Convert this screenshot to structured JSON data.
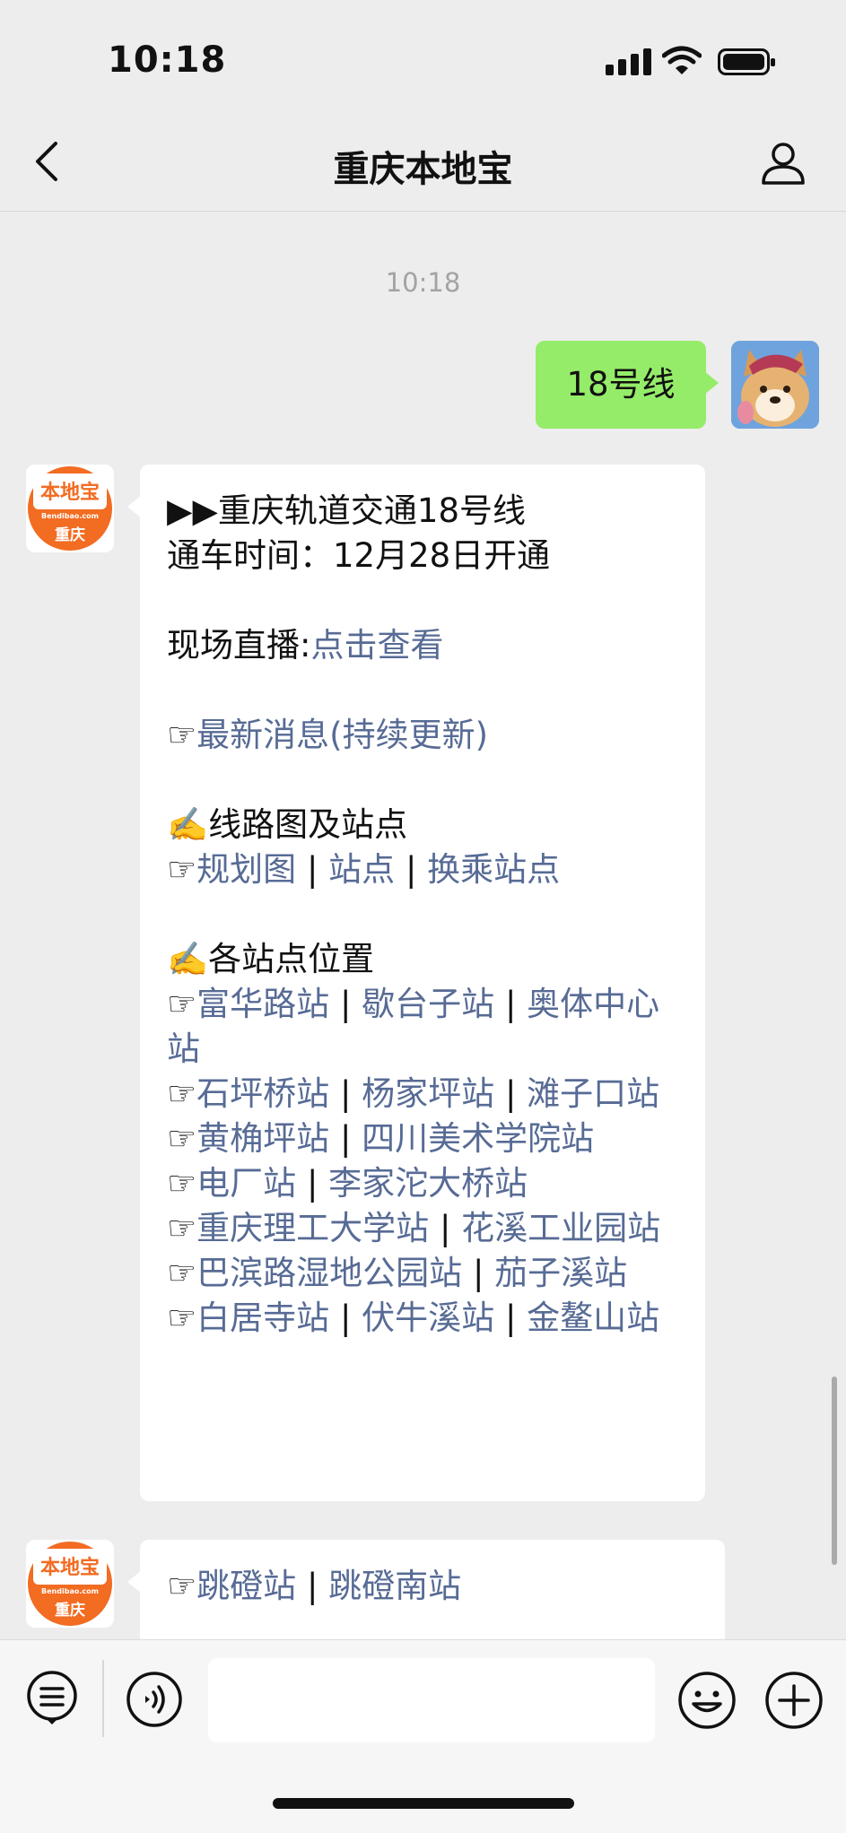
{
  "status_bar": {
    "time": "10:18"
  },
  "nav": {
    "title": "重庆本地宝"
  },
  "chat": {
    "timestamp": "10:18",
    "outgoing": {
      "text": "18号线"
    },
    "bot_avatar": {
      "logo_text": "本地宝",
      "site": "Bendibao.com",
      "city": "重庆"
    },
    "message1": {
      "title": "▶▶重庆轨道交通18号线",
      "opening": "通车时间：12月28日开通",
      "live_label": "现场直播:",
      "live_link": "点击查看",
      "hand": "☞",
      "news_link": "最新消息(持续更新)",
      "route_heading": "✍️线路图及站点",
      "route_links": [
        "规划图",
        "站点",
        "换乘站点"
      ],
      "stations_heading": "✍️各站点位置",
      "station_rows": [
        [
          "富华路站",
          "歇台子站",
          "奥体中心站"
        ],
        [
          "石坪桥站",
          "杨家坪站",
          "滩子口站"
        ],
        [
          "黄桷坪站",
          "四川美术学院站"
        ],
        [
          "电厂站",
          "李家沱大桥站"
        ],
        [
          "重庆理工大学站",
          "花溪工业园站"
        ],
        [
          "巴滨路湿地公园站",
          "茄子溪站"
        ],
        [
          "白居寺站",
          "伏牛溪站",
          "金鳌山站"
        ]
      ],
      "separator": "|"
    },
    "message2": {
      "links": [
        "跳磴站",
        "跳磴南站"
      ]
    }
  },
  "colors": {
    "background": "#ededed",
    "outgoing_bubble": "#95ec69",
    "link": "#576b95",
    "logo_orange": "#f26c22"
  },
  "icons": [
    "back-icon",
    "profile-icon",
    "menu-list-icon",
    "voice-icon",
    "emoji-icon",
    "plus-icon"
  ]
}
